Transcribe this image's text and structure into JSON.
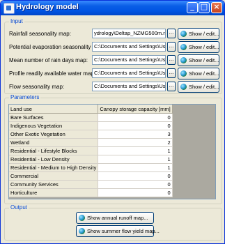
{
  "window": {
    "title": "Hydrology model"
  },
  "input_group": {
    "legend": "Input",
    "rows": [
      {
        "label": "Rainfall seasonality map:",
        "path": "ydrology\\Deltap_NZMG500m.rst",
        "browse": "...",
        "show": "Show / edit..."
      },
      {
        "label": "Potential evaporation seasonality map:",
        "path": "C:\\Documents and Settings\\User\\",
        "browse": "...",
        "show": "Show / edit..."
      },
      {
        "label": "Mean number of rain days map:",
        "path": "C:\\Documents and Settings\\User\\",
        "browse": "...",
        "show": "Show / edit..."
      },
      {
        "label": "Profile readily available water map:",
        "path": "C:\\Documents and Settings\\User\\",
        "browse": "...",
        "show": "Show / edit..."
      },
      {
        "label": "Flow seasonality map:",
        "path": "C:\\Documents and Settings\\User\\",
        "browse": "...",
        "show": "Show / edit..."
      }
    ]
  },
  "parameters_group": {
    "legend": "Parameters",
    "columns": [
      "Land use",
      "Canopy storage capacity [mm]"
    ],
    "rows": [
      {
        "land_use": "Bare Surfaces",
        "value": "0"
      },
      {
        "land_use": "Indigenous Vegetation",
        "value": "0"
      },
      {
        "land_use": "Other Exotic Vegetation",
        "value": "3"
      },
      {
        "land_use": "Wetland",
        "value": "2"
      },
      {
        "land_use": "Residential - Lifestyle Blocks",
        "value": "1"
      },
      {
        "land_use": "Residential - Low Density",
        "value": "1"
      },
      {
        "land_use": "Residential - Medium to High Density",
        "value": "1"
      },
      {
        "land_use": "Commercial",
        "value": "0"
      },
      {
        "land_use": "Community Services",
        "value": "0"
      },
      {
        "land_use": "Horticulture",
        "value": "0"
      }
    ]
  },
  "output_group": {
    "legend": "Output",
    "buttons": [
      "Show annual runoff map...",
      "Show summer flow yield map..."
    ]
  },
  "icons": {
    "app": "app-window-icon",
    "show": "globe-icon"
  },
  "colors": {
    "titlebar": "#0054E3",
    "legend": "#0046D5",
    "face": "#ECE9D8"
  }
}
